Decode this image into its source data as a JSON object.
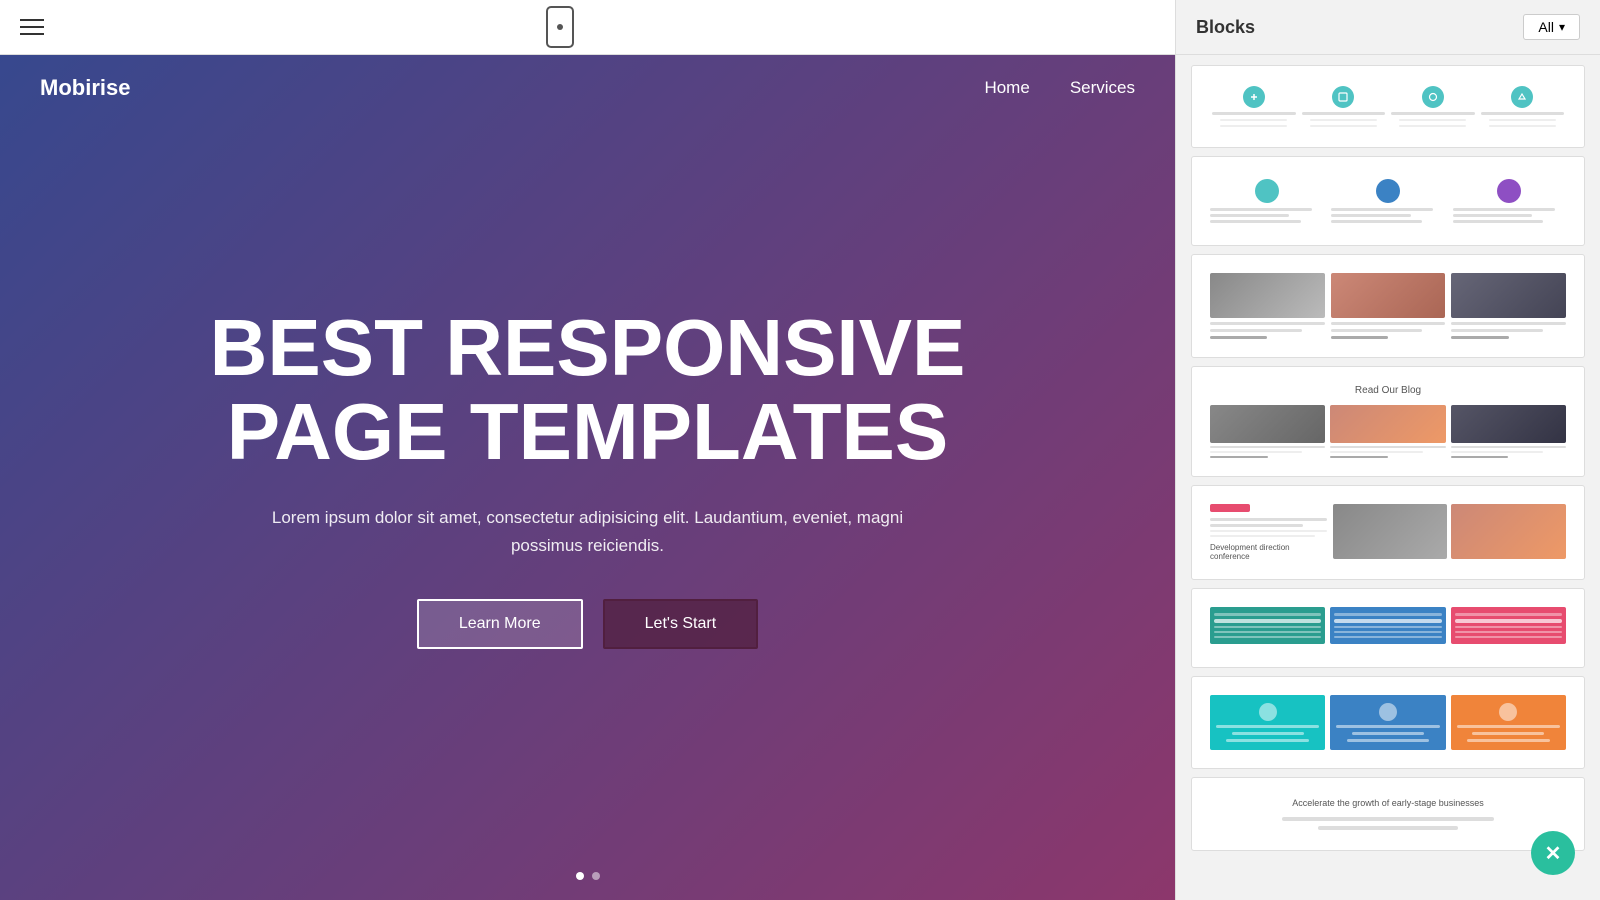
{
  "topbar": {
    "hamburger_label": "menu",
    "phone_label": "mobile preview"
  },
  "hero": {
    "logo": "Mobirise",
    "nav": {
      "home": "Home",
      "services": "Services"
    },
    "title_line1": "BEST RESPONSIVE",
    "title_line2": "PAGE TEMPLATES",
    "subtitle": "Lorem ipsum dolor sit amet, consectetur adipisicing elit. Laudantium, eveniet, magni possimus reiciendis.",
    "btn_learn_more": "Learn More",
    "btn_lets_start": "Let's Start"
  },
  "panel": {
    "title": "Blocks",
    "filter_label": "All",
    "block1_header": "Read Our Blog",
    "block5_title": "Development direction conference",
    "colors": {
      "teal": "#4fc3c3",
      "green_dark": "#3ea08a",
      "blue_feature": "#3b82c4",
      "purple_feature": "#8e4fc3",
      "pink_feature": "#e74c6f",
      "orange_feature": "#f59c3d",
      "cyan_box": "#17c2c2",
      "blue_box": "#3b82c4",
      "orange_box": "#f0843a"
    }
  }
}
